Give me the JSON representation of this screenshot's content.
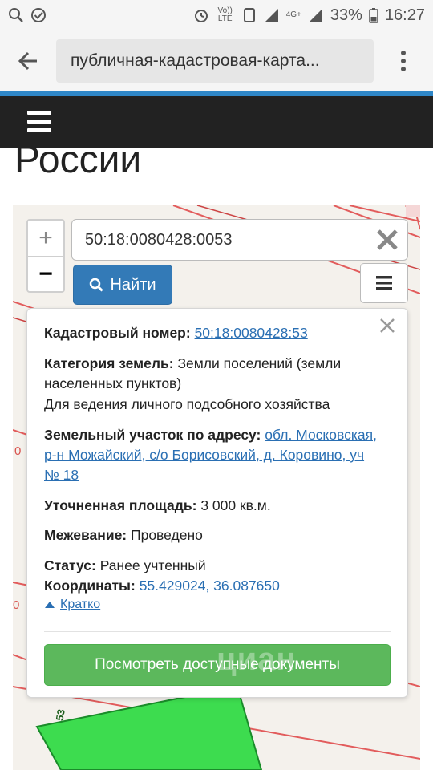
{
  "status_bar": {
    "battery": "33%",
    "time": "16:27",
    "network_labels": [
      "Vo)) LTE",
      "4G+"
    ]
  },
  "browser": {
    "url": "публичная-кадастровая-карта..."
  },
  "page": {
    "heading": "России"
  },
  "map": {
    "zoom_in": "+",
    "zoom_out": "−",
    "search_value": "50:18:0080428:0053",
    "find_label": "Найти",
    "parcel_number": "53",
    "edge_marks": [
      "0",
      "0"
    ]
  },
  "popup": {
    "cadastral_label": "Кадастровый номер:",
    "cadastral_value": "50:18:0080428:53",
    "category_label": "Категория земель:",
    "category_value_1": "Земли поселений (земли",
    "category_value_2": "населенных пунктов)",
    "usage": "Для ведения личного подсобного хозяйства",
    "address_label": "Земельный участок по адресу:",
    "address_value_1": "обл. Московская,",
    "address_value_2": "р-н Можайский, с/о Борисовский, д. Коровино, уч",
    "address_value_3": "№ 18",
    "area_label": "Уточненная площадь:",
    "area_value": "3 000 кв.м.",
    "survey_label": "Межевание:",
    "survey_value": "Проведено",
    "status_label": "Статус:",
    "status_value": "Ранее учтенный",
    "coords_label": "Координаты:",
    "coords_value": "55.429024, 36.087650",
    "brief_label": "Кратко",
    "docs_button": "Посмотреть доступные документы"
  },
  "watermark": "циан",
  "colors": {
    "accent": "#2f87c8",
    "nav_bg": "#222222",
    "primary_button": "#337ab7",
    "success_button": "#5cb85c",
    "parcel_green": "#3ddc4f",
    "boundary_red": "#d9534f"
  }
}
